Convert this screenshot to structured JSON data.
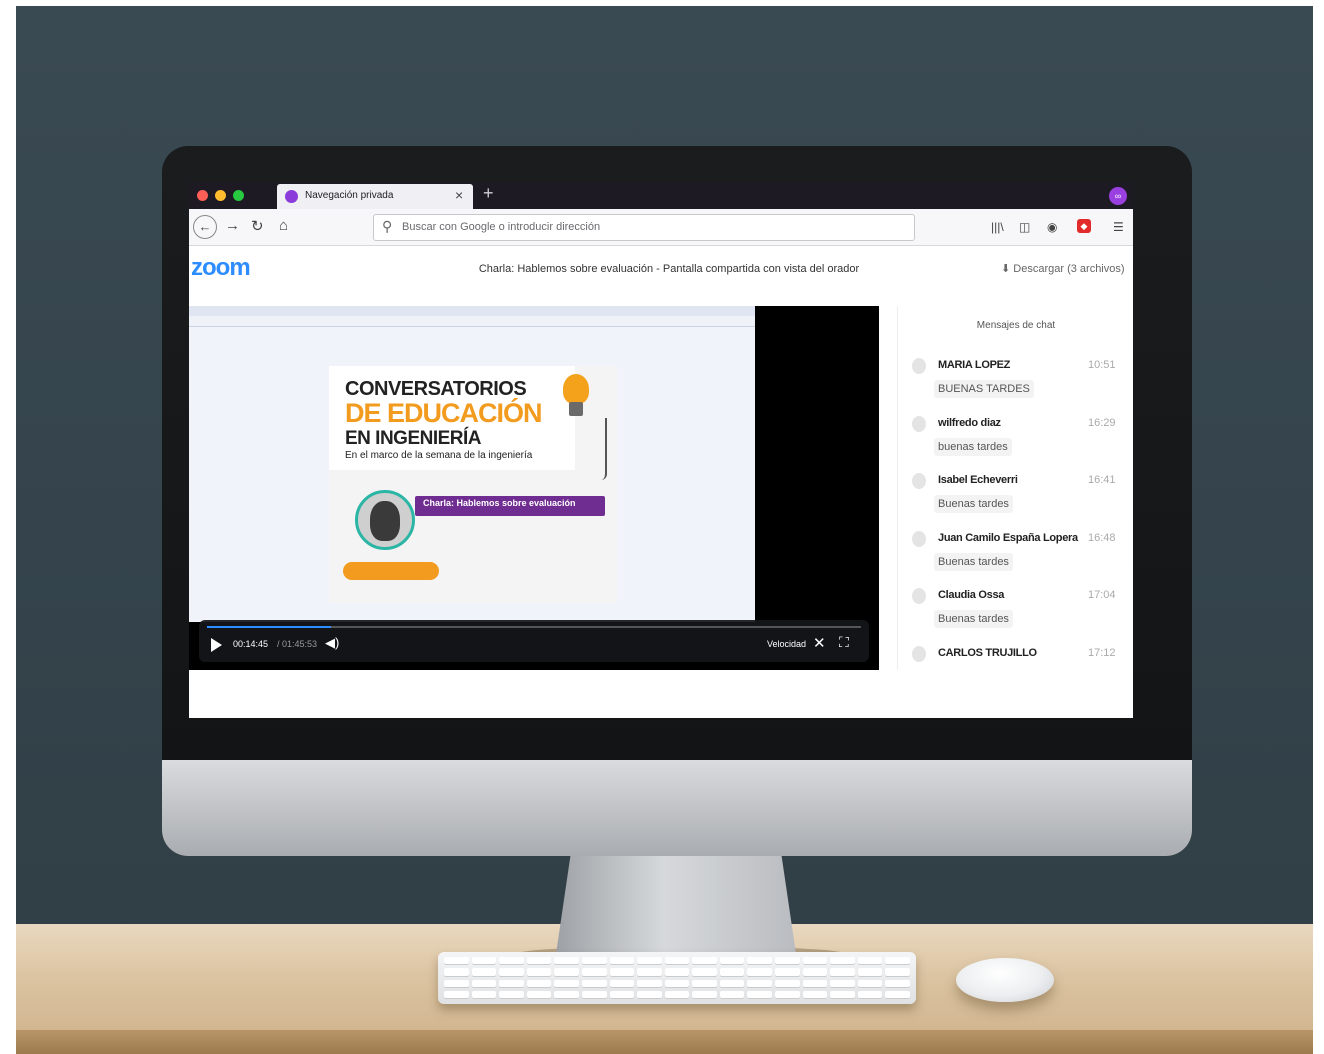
{
  "browser": {
    "tab_label": "Navegación privada",
    "tab_close": "×",
    "new_tab": "+",
    "private_icon": "∞",
    "url_placeholder": "Buscar con Google o introducir dirección",
    "window_controls": {
      "close": "#ff5f57",
      "minimize": "#febc2e",
      "maximize": "#28c840"
    }
  },
  "zoom": {
    "logo": "zoom",
    "title": "Charla: Hablemos sobre evaluación - Pantalla compartida con vista del orador",
    "download": "⬇ Descargar (3 archivos)"
  },
  "poster": {
    "line1": "CONVERSATORIOS",
    "line2": "DE EDUCACIÓN",
    "line3": "EN INGENIERÍA",
    "line4": "En el marco de la semana de la ingeniería",
    "charla_title": "Charla: Hablemos sobre evaluación"
  },
  "player": {
    "progress": 0.19,
    "current_time": "00:14:45",
    "total_time": "/ 01:45:53",
    "speed_label": "Velocidad"
  },
  "chat": {
    "header": "Mensajes de chat",
    "messages": [
      {
        "name": "MARIA LOPEZ",
        "time": "10:51",
        "text": "BUENAS TARDES"
      },
      {
        "name": "wilfredo diaz",
        "time": "16:29",
        "text": "buenas tardes"
      },
      {
        "name": "Isabel Echeverri",
        "time": "16:41",
        "text": "Buenas tardes"
      },
      {
        "name": "Juan Camilo España Lopera",
        "time": "16:48",
        "text": "Buenas tardes"
      },
      {
        "name": "Claudia Ossa",
        "time": "17:04",
        "text": "Buenas tardes"
      },
      {
        "name": "CARLOS TRUJILLO",
        "time": "17:12",
        "text": ""
      }
    ]
  },
  "colors": {
    "zoom_blue": "#2d8cff",
    "accent_purple": "#6f2c91",
    "accent_orange": "#f29b1e"
  }
}
